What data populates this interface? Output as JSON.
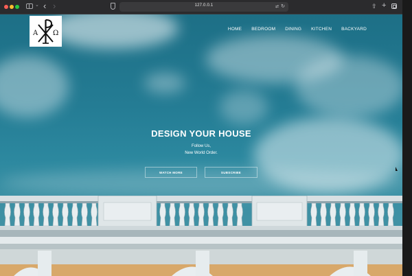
{
  "browser": {
    "url": "127.0.0.1",
    "icons": [
      "sidebar-icon",
      "back-icon",
      "forward-icon",
      "shield-icon",
      "translate-icon",
      "reload-icon",
      "share-icon",
      "new-tab-icon",
      "tabs-overview-icon"
    ]
  },
  "site": {
    "logo": {
      "letters": [
        "A",
        "Ω"
      ]
    },
    "nav": [
      "HOME",
      "BEDROOM",
      "DINING",
      "KITCHEN",
      "BACKYARD"
    ],
    "hero": {
      "title": "DESIGN YOUR HOUSE",
      "tagline_line1": "Follow Us,",
      "tagline_line2": "New World Order.",
      "buttons": [
        "WATCH MORE",
        "SUBSCRIBE"
      ]
    }
  },
  "colors": {
    "sky": "#247c94",
    "chrome": "#2b2b2d",
    "text": "#ffffff"
  }
}
